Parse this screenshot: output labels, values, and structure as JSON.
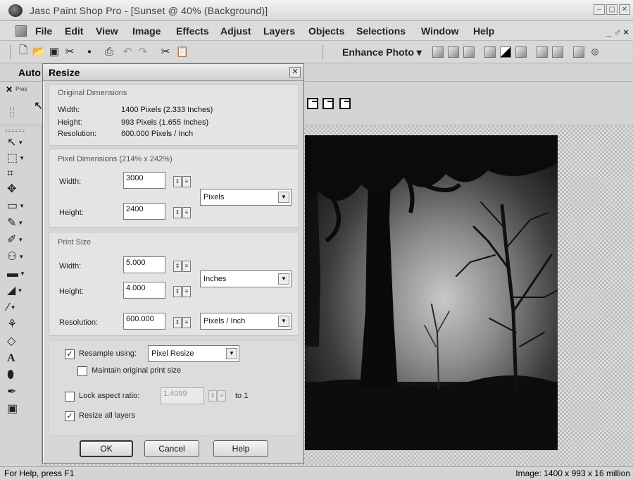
{
  "window": {
    "title": "Jasc Paint Shop Pro - [Sunset @  40% (Background)]",
    "controls": [
      "–",
      "▢",
      "✕"
    ]
  },
  "menu": {
    "items": [
      "File",
      "Edit",
      "View",
      "Image",
      "Effects",
      "Adjust",
      "Layers",
      "Objects",
      "Selections",
      "Window",
      "Help"
    ],
    "mdi_controls": "_ ♂ ×"
  },
  "toolbar": {
    "enhance_photo": "Enhance Photo ▾"
  },
  "tool_options": {
    "auto_label": "Auto",
    "presets_label": "Pres"
  },
  "dialog": {
    "title": "Resize",
    "original": {
      "title": "Original Dimensions",
      "width_label": "Width:",
      "width_value": "1400 Pixels (2.333 Inches)",
      "height_label": "Height:",
      "height_value": "993 Pixels (1.655 Inches)",
      "resolution_label": "Resolution:",
      "resolution_value": "600.000 Pixels / Inch"
    },
    "pixel_dimensions": {
      "title": "Pixel Dimensions (214% x 242%)",
      "width_label": "Width:",
      "width_value": "3000",
      "height_label": "Height:",
      "height_value": "2400",
      "units": "Pixels"
    },
    "print_size": {
      "title": "Print Size",
      "width_label": "Width:",
      "width_value": "5.000",
      "height_label": "Height:",
      "height_value": "4.000",
      "units": "Inches",
      "resolution_label": "Resolution:",
      "resolution_value": "600.000",
      "resolution_units": "Pixels / Inch"
    },
    "options": {
      "resample_label": "Resample using:",
      "resample_checked": true,
      "resample_method": "Pixel Resize",
      "maintain_label": "Maintain original print size",
      "maintain_checked": false,
      "lock_label": "Lock aspect ratio:",
      "lock_checked": false,
      "aspect_value": "1.4099",
      "aspect_suffix": "to 1",
      "resize_all_label": "Resize all layers",
      "resize_all_checked": true
    },
    "buttons": {
      "ok": "OK",
      "cancel": "Cancel",
      "help": "Help"
    }
  },
  "status": {
    "left": "For Help, press F1",
    "right": "Image:  1400 x 993 x 16 million"
  }
}
